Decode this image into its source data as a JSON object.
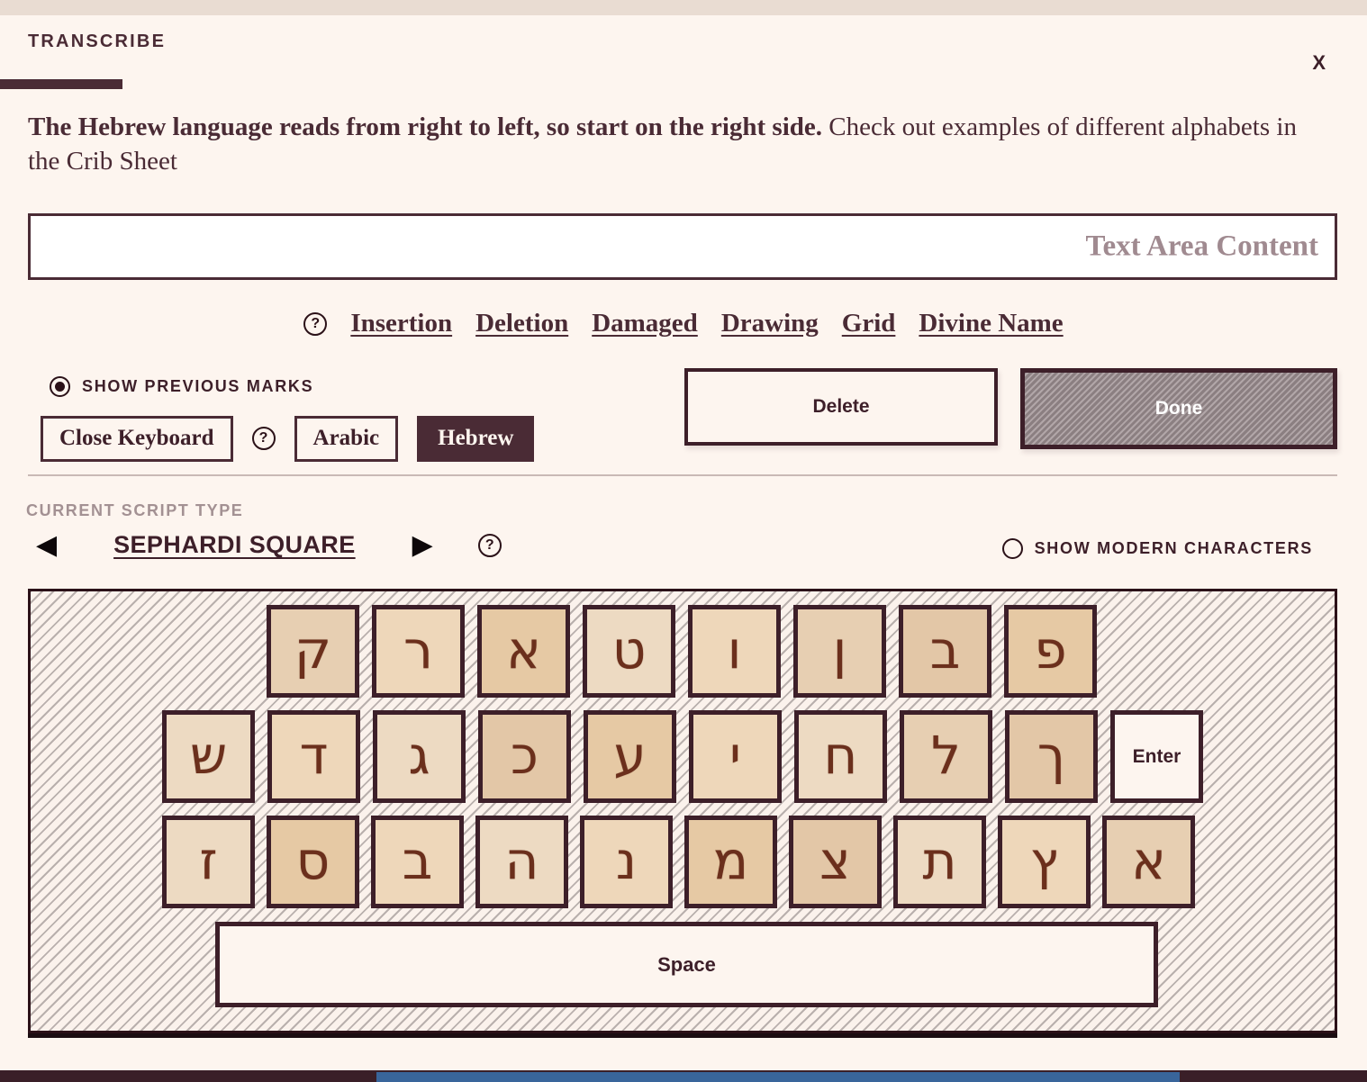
{
  "header": {
    "title": "TRANSCRIBE",
    "close_label": "X"
  },
  "instructions": {
    "bold": "The Hebrew language reads from right to left, so start on the right side.",
    "rest": " Check out examples of different alphabets in the Crib Sheet"
  },
  "text_area": {
    "value": "",
    "placeholder": "Text Area Content"
  },
  "markup_toolbar": {
    "help_icon": "?",
    "items": [
      {
        "label": "Insertion"
      },
      {
        "label": "Deletion"
      },
      {
        "label": "Damaged"
      },
      {
        "label": "Drawing"
      },
      {
        "label": "Grid"
      },
      {
        "label": "Divine Name"
      }
    ]
  },
  "previous_marks": {
    "label": "SHOW PREVIOUS MARKS",
    "checked": true
  },
  "keyboard_controls": {
    "close_keyboard_label": "Close Keyboard",
    "help_icon": "?",
    "arabic_label": "Arabic",
    "hebrew_label": "Hebrew",
    "selected_language": "Hebrew"
  },
  "actions": {
    "delete_label": "Delete",
    "done_label": "Done",
    "done_disabled": true
  },
  "script_type": {
    "section_label": "CURRENT SCRIPT TYPE",
    "prev_arrow": "◀",
    "name": "SEPHARDI SQUARE",
    "next_arrow": "▶",
    "help_icon": "?"
  },
  "modern_characters": {
    "label": "SHOW MODERN CHARACTERS",
    "checked": false
  },
  "keyboard": {
    "rows": [
      [
        {
          "name": "qof",
          "glyph": "ק"
        },
        {
          "name": "resh",
          "glyph": "ר"
        },
        {
          "name": "alef",
          "glyph": "א"
        },
        {
          "name": "tet",
          "glyph": "ט"
        },
        {
          "name": "vav",
          "glyph": "ו"
        },
        {
          "name": "final-nun",
          "glyph": "ן"
        },
        {
          "name": "bet",
          "glyph": "ב"
        },
        {
          "name": "pe",
          "glyph": "פ"
        }
      ],
      [
        {
          "name": "shin",
          "glyph": "ש"
        },
        {
          "name": "dalet",
          "glyph": "ד"
        },
        {
          "name": "gimel",
          "glyph": "ג"
        },
        {
          "name": "kaf",
          "glyph": "כ"
        },
        {
          "name": "ayin",
          "glyph": "ע"
        },
        {
          "name": "yod",
          "glyph": "י"
        },
        {
          "name": "het",
          "glyph": "ח"
        },
        {
          "name": "lamed",
          "glyph": "ל"
        },
        {
          "name": "final-kaf",
          "glyph": "ך"
        }
      ],
      [
        {
          "name": "zayin",
          "glyph": "ז"
        },
        {
          "name": "samekh",
          "glyph": "ס"
        },
        {
          "name": "vet",
          "glyph": "ב"
        },
        {
          "name": "he",
          "glyph": "ה"
        },
        {
          "name": "nun",
          "glyph": "נ"
        },
        {
          "name": "mem",
          "glyph": "מ"
        },
        {
          "name": "tsadi",
          "glyph": "צ"
        },
        {
          "name": "tav",
          "glyph": "ת"
        },
        {
          "name": "final-tsadi",
          "glyph": "ץ"
        },
        {
          "name": "alef2",
          "glyph": "א"
        }
      ]
    ],
    "enter_label": "Enter",
    "space_label": "Space"
  },
  "colors": {
    "accent": "#4a2b35",
    "page_bg": "#fdf5ef",
    "top_strip": "#e9dcd2",
    "placeholder": "#a08a90",
    "muted_label": "#a39193",
    "disabled_fill": "#9b8d90",
    "footer_blue": "#39659b"
  }
}
